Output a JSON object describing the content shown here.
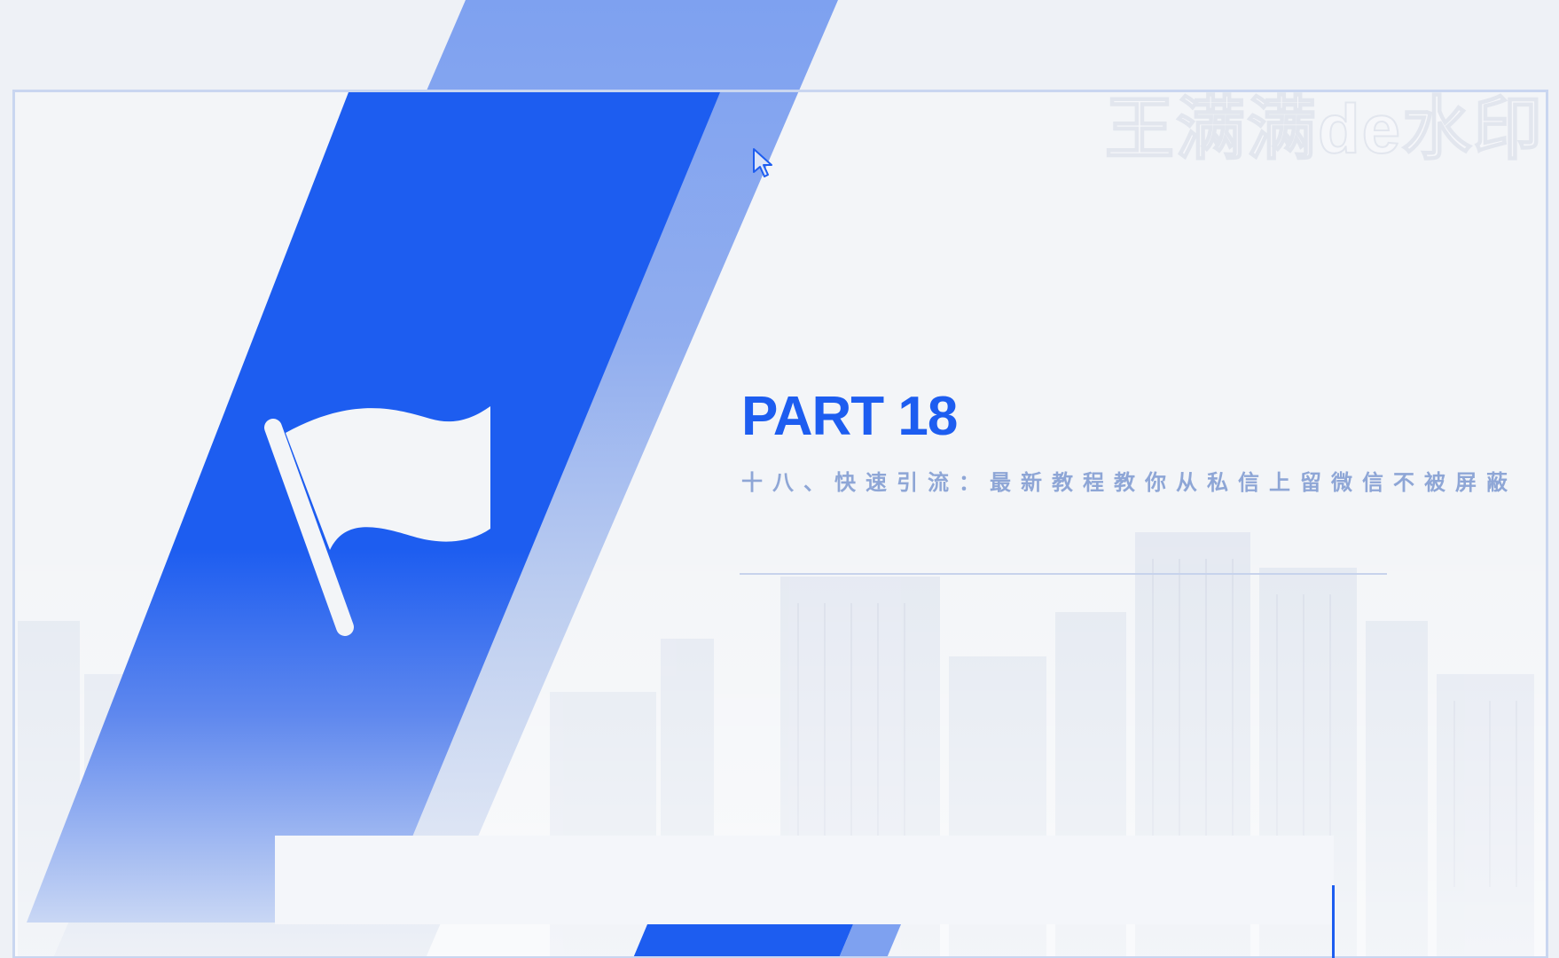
{
  "slide": {
    "part_label": "PART 18",
    "subtitle": "十八、快速引流：最新教程教你从私信上留微信不被屏蔽",
    "watermark": "王满满de水印"
  },
  "icons": {
    "flag": "flag-icon",
    "cursor": "mouse-cursor-icon"
  },
  "colors": {
    "accent": "#1d5df0",
    "accent_light": "#7c9ff0",
    "background": "#eef1f6",
    "subtitle": "#8ea6d6"
  }
}
